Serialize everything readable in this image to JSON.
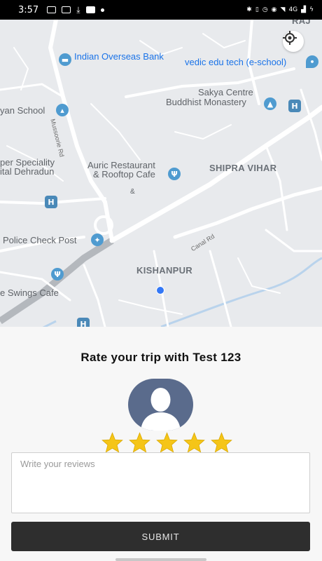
{
  "status_bar": {
    "time": "3:57",
    "network": "4G"
  },
  "map": {
    "labels": {
      "bank": "Indian Overseas Bank",
      "edu_tech": "vedic edu tech (e-school)",
      "school": "yan School",
      "monastery_1": "Sakya Centre",
      "monastery_2": "Buddhist Monastery",
      "hospital_1": "per Speciality",
      "hospital_2": "ital Dehradun",
      "restaurant_1": "Auric Restaurant",
      "restaurant_2": "& Rooftop Cafe",
      "area_shipra": "SHIPRA VIHAR",
      "police": "Police Check Post",
      "area_kishanpur": "KISHANPUR",
      "cafe": "e Swings Cafe",
      "road_mussoorie": "Mussoorie Rd",
      "road_canal": "Canal Rd",
      "corner": "RAJ",
      "amp": "&"
    }
  },
  "rating": {
    "title": "Rate your trip with Test 123",
    "stars": 5,
    "max_stars": 5,
    "star_color": "#f5c518",
    "review_placeholder": "Write your reviews",
    "review_value": "",
    "submit_label": "SUBMIT"
  }
}
